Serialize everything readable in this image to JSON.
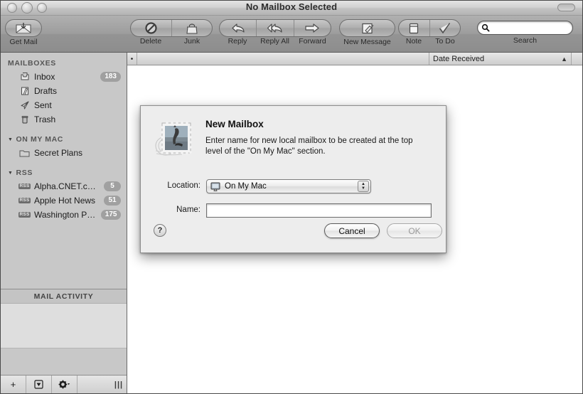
{
  "window": {
    "title": "No Mailbox Selected",
    "controls": [
      "close-button",
      "minimize-button",
      "zoom-button"
    ],
    "toolbar_toggle": "toolbar-toggle-pill"
  },
  "toolbar": {
    "items": [
      {
        "label": "Get Mail",
        "icon": "envelope-arrow-icon",
        "group": "single"
      },
      {
        "label": "Delete",
        "icon": "delete-no-entry-icon",
        "group": "delete-junk"
      },
      {
        "label": "Junk",
        "icon": "junk-bag-icon",
        "group": "delete-junk"
      },
      {
        "label": "Reply",
        "icon": "reply-arrow-icon",
        "group": "reply-group"
      },
      {
        "label": "Reply All",
        "icon": "reply-all-arrow-icon",
        "group": "reply-group"
      },
      {
        "label": "Forward",
        "icon": "forward-arrow-icon",
        "group": "reply-group"
      },
      {
        "label": "New Message",
        "icon": "compose-pencil-icon",
        "group": "single"
      },
      {
        "label": "Note",
        "icon": "note-pad-icon",
        "group": "note-todo"
      },
      {
        "label": "To Do",
        "icon": "todo-check-icon",
        "group": "note-todo"
      }
    ],
    "search": {
      "label": "Search",
      "placeholder": "",
      "value": "",
      "icon": "search-magnifier-icon"
    }
  },
  "sidebar": {
    "sections": [
      {
        "title": "MAILBOXES",
        "collapsible": false,
        "items": [
          {
            "label": "Inbox",
            "icon": "inbox-tray-icon",
            "count": "183"
          },
          {
            "label": "Drafts",
            "icon": "drafts-pencil-icon",
            "count": ""
          },
          {
            "label": "Sent",
            "icon": "sent-paperplane-icon",
            "count": ""
          },
          {
            "label": "Trash",
            "icon": "trash-can-icon",
            "count": ""
          }
        ]
      },
      {
        "title": "ON MY MAC",
        "collapsible": true,
        "items": [
          {
            "label": "Secret Plans",
            "icon": "folder-icon",
            "count": ""
          }
        ]
      },
      {
        "title": "RSS",
        "collapsible": true,
        "items": [
          {
            "label": "Alpha.CNET.com:...",
            "icon": "rss-badge-icon",
            "count": "5"
          },
          {
            "label": "Apple Hot News",
            "icon": "rss-badge-icon",
            "count": "51"
          },
          {
            "label": "Washington Post",
            "icon": "rss-badge-icon",
            "count": "175"
          }
        ]
      }
    ],
    "rss_badge_text": "RSS",
    "activity": {
      "title": "MAIL ACTIVITY"
    },
    "bottom_bar": {
      "add_label": "+",
      "actions_icon": "mailbox-actions-icon",
      "settings_icon": "gear-icon",
      "resize_grip_icon": "resize-grip-icon"
    }
  },
  "message_list": {
    "columns": [
      {
        "label": "",
        "name": "unread-dot-column"
      },
      {
        "label": "",
        "name": "subject-column"
      },
      {
        "label": "Date Received",
        "name": "date-received-column",
        "sort": "▲"
      }
    ],
    "rows": []
  },
  "dialog": {
    "icon": "mail-stamp-icon",
    "title": "New Mailbox",
    "message": "Enter name for new local mailbox to be created at the top level of the \"On My Mac\" section.",
    "location": {
      "label": "Location:",
      "value": "On My Mac",
      "icon": "computer-display-icon",
      "stepper_up": "▲",
      "stepper_down": "▼"
    },
    "name": {
      "label": "Name:",
      "value": "",
      "placeholder": ""
    },
    "help_button": "?",
    "buttons": {
      "cancel": "Cancel",
      "ok": "OK"
    }
  },
  "colors": {
    "sidebar_bg": "#c8c8c8",
    "toolbar_bg": "#9d9d9d",
    "dialog_bg": "#ededed",
    "badge_bg": "#a0a0a0",
    "content_bg": "#ffffff"
  }
}
